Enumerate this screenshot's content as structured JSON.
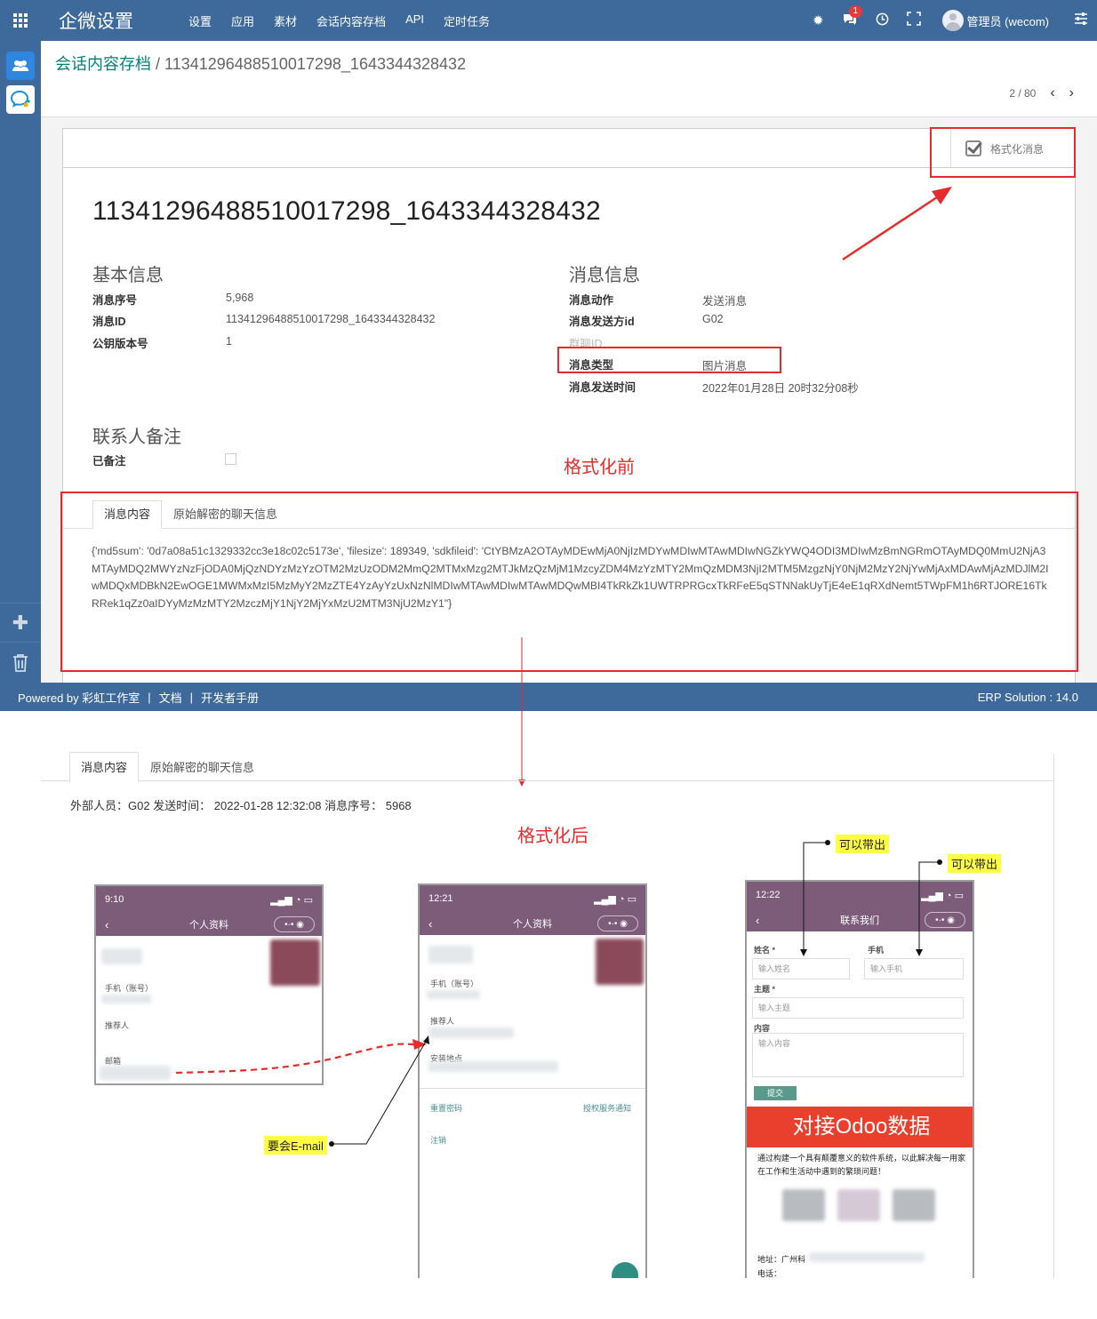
{
  "navbar": {
    "app_title": "企微设置",
    "menu": [
      "设置",
      "应用",
      "素材",
      "会话内容存档",
      "API",
      "定时任务"
    ],
    "message_count": "1",
    "user_name": "管理员 (wecom)"
  },
  "breadcrumb": {
    "parent": "会话内容存档",
    "separator": "/",
    "current": "11341296488510017298_1643344328432"
  },
  "pager": {
    "value": "2 / 80",
    "prev": "‹",
    "next": "›"
  },
  "format_button": {
    "label": "格式化消息"
  },
  "record": {
    "title": "11341296488510017298_1643344328432",
    "basic": {
      "title": "基本信息",
      "seq_label": "消息序号",
      "seq_value": "5,968",
      "id_label": "消息ID",
      "id_value": "11341296488510017298_1643344328432",
      "pubkey_label": "公钥版本号",
      "pubkey_value": "1"
    },
    "message": {
      "title": "消息信息",
      "action_label": "消息动作",
      "action_value": "发送消息",
      "from_label": "消息发送方id",
      "from_value": "G02",
      "room_label": "群聊ID",
      "type_label": "消息类型",
      "type_value": "图片消息",
      "time_label": "消息发送时间",
      "time_value": "2022年01月28日 20时32分08秒"
    },
    "contact": {
      "title": "联系人备注",
      "remarked_label": "已备注"
    },
    "tabs": [
      "消息内容",
      "原始解密的聊天信息"
    ],
    "raw_content": "{'md5sum': '0d7a08a51c1329332cc3e18c02c5173e', 'filesize': 189349, 'sdkfileid': 'CtYBMzA2OTAyMDEwMjA0NjIzMDYwMDIwMTAwMDIwNGZkYWQ4ODI3MDIwMzBmNGRmOTAyMDQ0MmU2NjA3MTAyMDQ2MWYzNzFjODA0MjQzNDYzMzYzOTM2MzUzODM2MmQ2MTMxMzg2MTJkMzQzMjM1MzcyZDM4MzYzMTY2MmQzMDM3NjI2MTM5MzgzNjY0NjM2MzY2NjYwMjAxMDAwMjAzMDJlM2IwMDQxMDBkN2EwOGE1MWMxMzI5MzMyY2MzZTE4YzAyYzUxNzNlMDIwMTAwMDIwMTAwMDQwMBI4TkRkZk1UWTRPRGcxTkRFeE5qSTNNakUyTjE4eE1qRXdNemt5TWpFM1h6RTJORE16TkRRek1qZz0aIDYyMzMzMTY2MzczMjY1NjY2MjYxMzU2MTM3NjU2MzY1\"}"
  },
  "footer": {
    "powered": "Powered by 彩虹工作室",
    "docs": "文档",
    "dev_manual": "开发者手册",
    "divider": "|",
    "version": "ERP Solution : 14.0"
  },
  "annotations": {
    "before": "格式化前",
    "after": "格式化后",
    "can_bring_out": "可以带出",
    "need_email": "要会E-mail"
  },
  "formatted": {
    "tabs": [
      "消息内容",
      "原始解密的聊天信息"
    ],
    "info": "外部人员：G02 发送时间：  2022-01-28 12:32:08 消息序号：  5968"
  },
  "phones": {
    "p1": {
      "time": "9:10",
      "title": "个人资料",
      "phone_label": "手机（账号）",
      "referrer": "推荐人",
      "email": "邮箱"
    },
    "p2": {
      "time": "12:21",
      "title": "个人资料",
      "phone_label": "手机（账号）",
      "referrer": "推荐人",
      "install_site": "安装地点",
      "reset_pwd": "重置密码",
      "auth_notice": "授权服务通知",
      "logout": "注销"
    },
    "p3": {
      "time": "12:22",
      "title": "联系我们",
      "name_label": "姓名 *",
      "phone_label": "手机",
      "name_ph": "输入姓名",
      "phone_ph": "输入手机",
      "subject_label": "主题 *",
      "subject_ph": "输入主题",
      "content_label": "内容",
      "content_ph": "输入内容",
      "submit": "提交",
      "banner": "对接Odoo数据",
      "desc": "通过构建一个具有颠覆意义的软件系统，以此解决每一用家在工作和生活动中遇到的繁琐问题！",
      "address": "地址：广州科",
      "tel": "电话："
    }
  },
  "colors": {
    "navbar": "#3d6a9a",
    "accent_red": "#e52b2b",
    "odoo_teal": "#00807a",
    "phone_header": "#7d5c7a"
  }
}
